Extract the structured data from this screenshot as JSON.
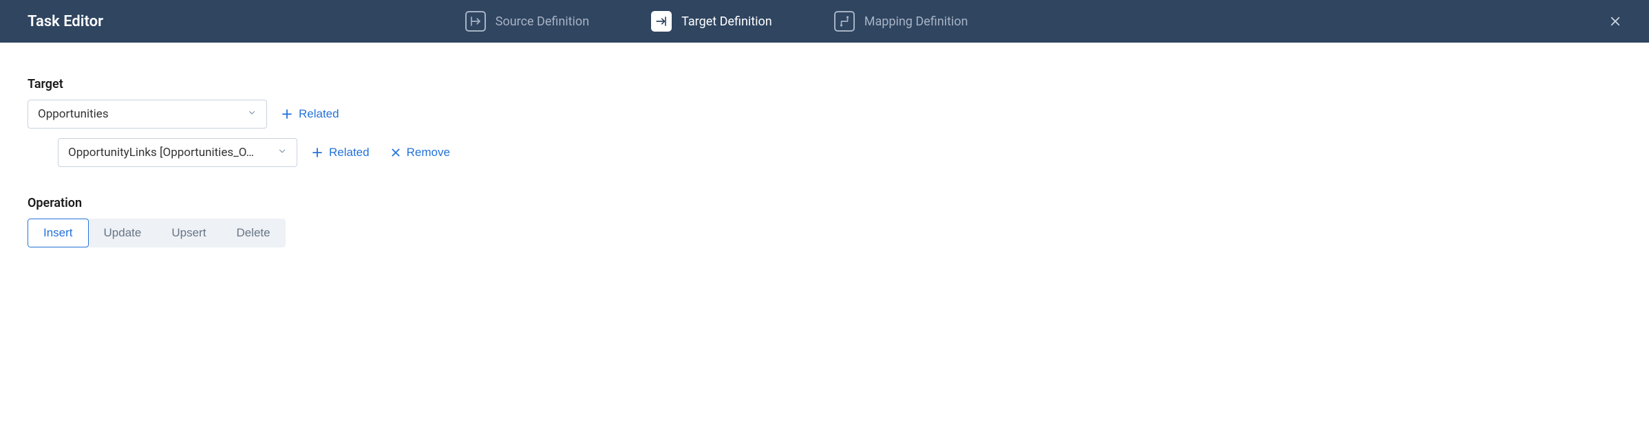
{
  "header": {
    "title": "Task Editor",
    "tabs": {
      "source": "Source Definition",
      "target": "Target Definition",
      "mapping": "Mapping Definition"
    }
  },
  "target": {
    "label": "Target",
    "primary": "Opportunities",
    "child": "OpportunityLinks [Opportunities_O…",
    "related": "Related",
    "remove": "Remove"
  },
  "operation": {
    "label": "Operation",
    "insert": "Insert",
    "update": "Update",
    "upsert": "Upsert",
    "delete": "Delete"
  }
}
